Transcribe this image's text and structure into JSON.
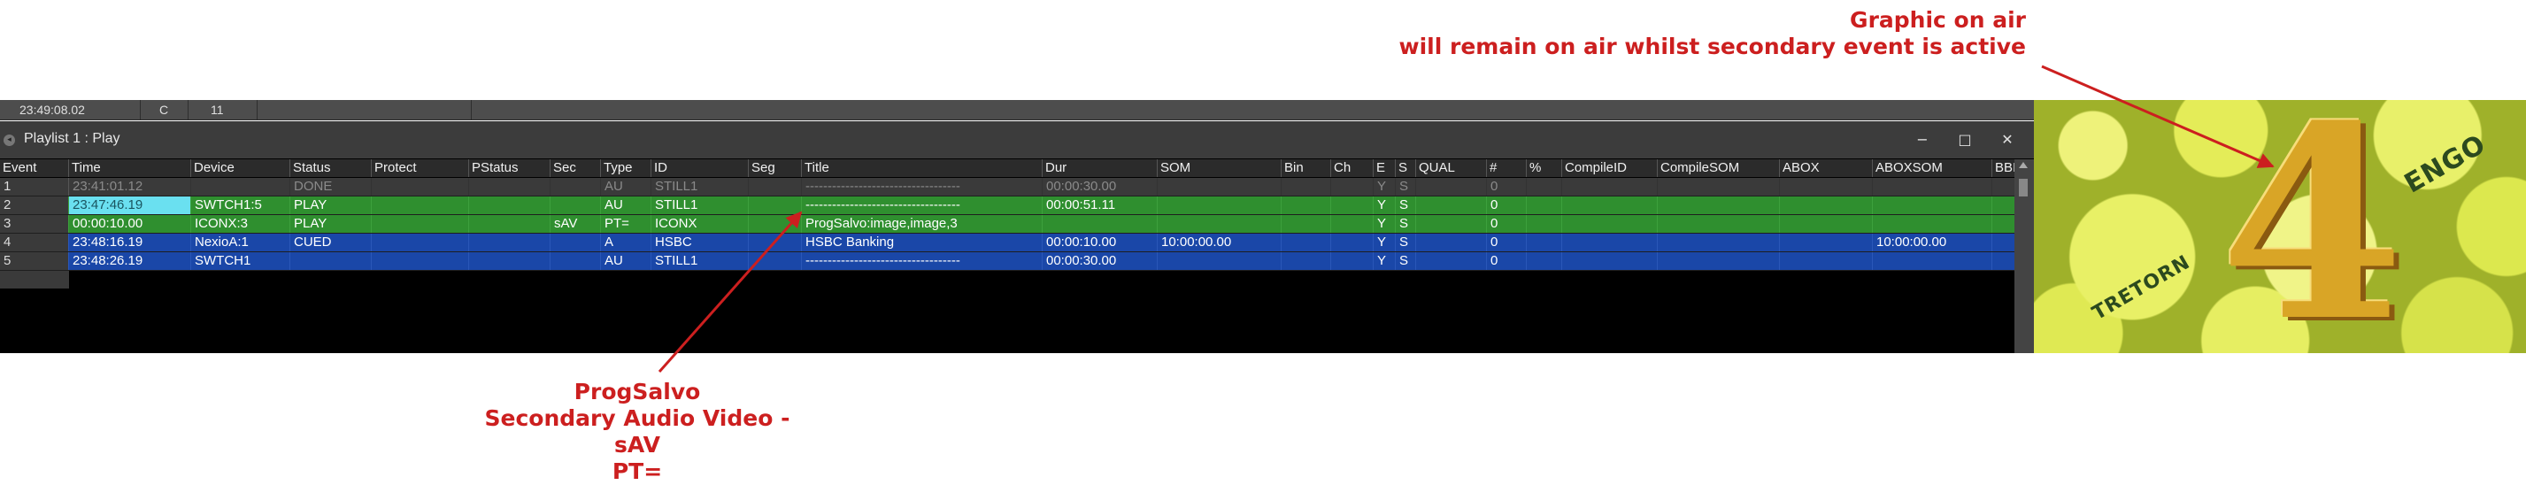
{
  "annotations": {
    "top": [
      "Graphic on air",
      "will remain on air whilst secondary event is active"
    ],
    "bottom": [
      "ProgSalvo",
      "Secondary Audio Video - sAV",
      "PT="
    ]
  },
  "topstrip": {
    "time": "23:49:08.02",
    "col2": "C",
    "col3": "11"
  },
  "window": {
    "title": "Playlist 1 : Play",
    "minimize": "−",
    "maximize": "□",
    "close": "✕"
  },
  "columns": [
    "Event",
    "Time",
    "Device",
    "Status",
    "Protect",
    "PStatus",
    "Sec",
    "Type",
    "ID",
    "Seg",
    "Title",
    "Dur",
    "SOM",
    "Bin",
    "Ch",
    "E",
    "S",
    "QUAL",
    "#",
    "%",
    "CompileID",
    "CompileSOM",
    "ABOX",
    "ABOXSOM",
    "BBI"
  ],
  "rows": [
    {
      "state": "done",
      "cells": [
        "1",
        "23:41:01.12",
        "",
        "DONE",
        "",
        "",
        "",
        "AU",
        "STILL1",
        "",
        "-----------------------------------",
        "00:00:30.00",
        "",
        "",
        "",
        "Y",
        "S",
        "",
        "0",
        "",
        "",
        "",
        "",
        "",
        ""
      ]
    },
    {
      "state": "play",
      "cells": [
        "2",
        "23:47:46.19",
        "SWTCH1:5",
        "PLAY",
        "",
        "",
        "",
        "AU",
        "STILL1",
        "",
        "-----------------------------------",
        "00:00:51.11",
        "",
        "",
        "",
        "Y",
        "S",
        "",
        "0",
        "",
        "",
        "",
        "",
        "",
        ""
      ]
    },
    {
      "state": "play",
      "cells": [
        "3",
        "00:00:10.00",
        "ICONX:3",
        "PLAY",
        "",
        "",
        "sAV",
        "PT=",
        "ICONX",
        "",
        "ProgSalvo:image,image,3",
        "",
        "",
        "",
        "",
        "Y",
        "S",
        "",
        "0",
        "",
        "",
        "",
        "",
        "",
        ""
      ]
    },
    {
      "state": "cued",
      "cells": [
        "4",
        "23:48:16.19",
        "NexioA:1",
        "CUED",
        "",
        "",
        "",
        "A",
        "HSBC",
        "",
        "HSBC Banking",
        "00:00:10.00",
        "10:00:00.00",
        "",
        "",
        "Y",
        "S",
        "",
        "0",
        "",
        "",
        "",
        "",
        "10:00:00.00",
        ""
      ]
    },
    {
      "state": "cued",
      "cells": [
        "5",
        "23:48:26.19",
        "SWTCH1",
        "",
        "",
        "",
        "",
        "AU",
        "STILL1",
        "",
        "-----------------------------------",
        "00:00:30.00",
        "",
        "",
        "",
        "Y",
        "S",
        "",
        "0",
        "",
        "",
        "",
        "",
        "",
        ""
      ]
    }
  ],
  "preview": {
    "digit": "4",
    "ball_label": "ENGO",
    "ball_label_2": "TRETORN",
    "colors": {
      "digit": "#d9a526",
      "balls": "#e8f06a"
    }
  },
  "colors": {
    "annotation": "#cc1f1f",
    "play_row": "#2f8f2f",
    "cued_row": "#1a47a8",
    "done_row": "#3a3a3a",
    "time_highlight": "#6ae0f0"
  }
}
